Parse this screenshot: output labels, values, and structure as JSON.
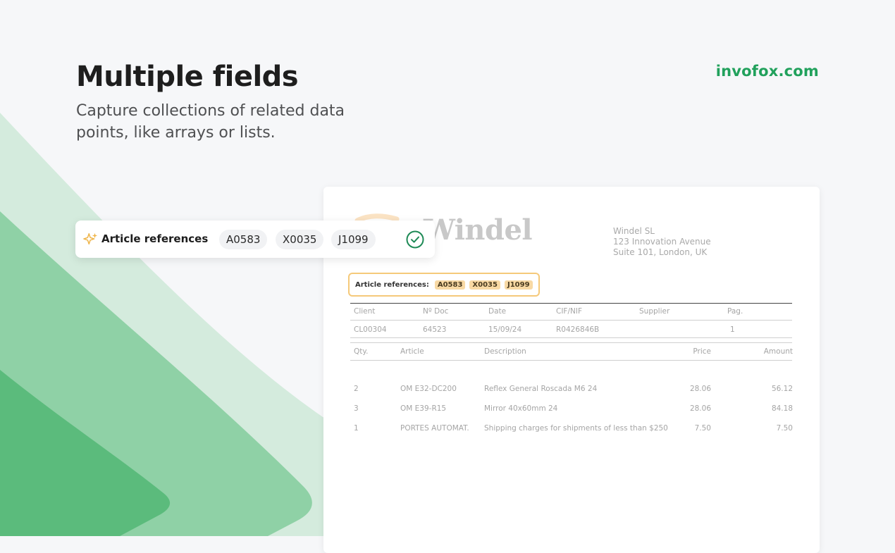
{
  "header": {
    "title": "Multiple fields",
    "subtitle": "Capture collections of related data points, like arrays or lists.",
    "brand": "invofox.com"
  },
  "colors": {
    "brand_green": "#21a15c",
    "highlight": "#f5c97a",
    "check_green": "#1e8a56"
  },
  "field_card": {
    "label": "Article references",
    "values": [
      "A0583",
      "X0035",
      "J1099"
    ],
    "icons": {
      "lead": "sparkle-icon",
      "status": "check-circle-icon"
    }
  },
  "invoice": {
    "company": "Windel",
    "address": [
      "Windel SL",
      "123 Innovation Avenue",
      "Suite 101, London, UK"
    ],
    "refs_label": "Article references:",
    "refs": [
      "A0583",
      "X0035",
      "J1099"
    ],
    "meta_headers": [
      "Client",
      "Nº Doc",
      "Date",
      "CIF/NIF",
      "Supplier",
      "Pag."
    ],
    "meta_values": [
      "CL00304",
      "64523",
      "15/09/24",
      "R0426846B",
      "",
      "1"
    ],
    "item_headers": [
      "Qty.",
      "Article",
      "Description",
      "Price",
      "Amount"
    ],
    "items": [
      [
        "2",
        "OM E32-DC200",
        "Reflex General Roscada M6 24",
        "28.06",
        "56.12"
      ],
      [
        "3",
        "OM E39-R15",
        "Mirror 40x60mm 24",
        "28.06",
        "84.18"
      ],
      [
        "1",
        "PORTES AUTOMAT.",
        "Shipping charges for shipments of less than $250",
        "7.50",
        "7.50"
      ]
    ]
  }
}
